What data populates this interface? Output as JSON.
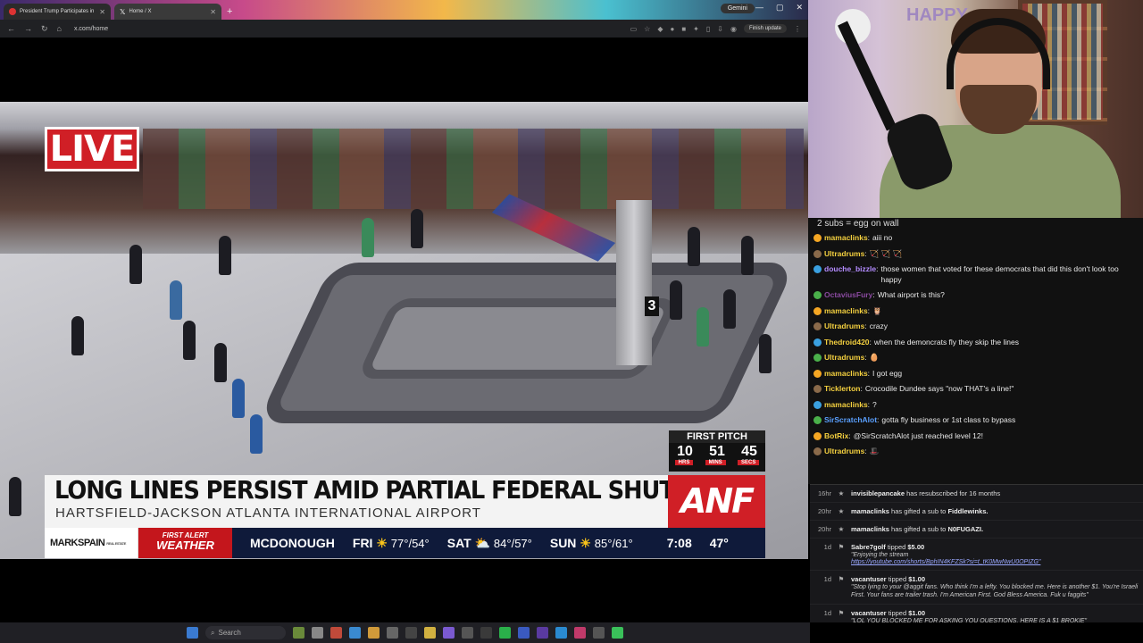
{
  "browser": {
    "tabs": [
      {
        "title": "President Trump Participates in",
        "active": false
      },
      {
        "title": "Home / X",
        "active": true
      }
    ],
    "gemini_label": "Gemini",
    "url": "x.com/home",
    "finish_update": "Finish update"
  },
  "broadcast": {
    "live": "LIVE",
    "gate_number": "3",
    "first_pitch": {
      "title": "FIRST PITCH",
      "hrs": "10",
      "mins": "51",
      "secs": "45",
      "hrs_label": "HRS",
      "mins_label": "MINS",
      "secs_label": "SECS"
    },
    "headline": "LONG LINES PERSIST AMID PARTIAL FEDERAL SHUTDOWN",
    "subheadline": "HARTSFIELD-JACKSON ATLANTA INTERNATIONAL AIRPORT",
    "network": "ANF",
    "sponsor": "MARKSPAIN",
    "sponsor_sub": "REAL ESTATE",
    "weather_label_top": "FIRST ALERT",
    "weather_label": "WEATHER",
    "city": "MCDONOUGH",
    "forecast": [
      {
        "day": "FRI",
        "temps": "77°/54°",
        "icon": "sun-icon"
      },
      {
        "day": "SAT",
        "temps": "84°/57°",
        "icon": "partly-cloudy-icon"
      },
      {
        "day": "SUN",
        "temps": "85°/61°",
        "icon": "sun-icon"
      }
    ],
    "time": "7:08",
    "current_temp": "47°"
  },
  "chat": {
    "banner": "2 subs = egg on wall",
    "messages": [
      {
        "user": "mamaclinks",
        "color": "#f4d03f",
        "text": "aiii no"
      },
      {
        "user": "Ultradrums",
        "color": "#f4d03f",
        "text": "🏹 🏹 🏹"
      },
      {
        "user": "douche_bizzle",
        "color": "#b48cff",
        "text": "those women that voted for these democrats that did this don't look too happy"
      },
      {
        "user": "OctaviusFury",
        "color": "#8a4aa0",
        "text": "What airport is this?"
      },
      {
        "user": "mamaclinks",
        "color": "#f4d03f",
        "text": "🦉"
      },
      {
        "user": "Ultradrums",
        "color": "#f4d03f",
        "text": "crazy"
      },
      {
        "user": "Thedroid420",
        "color": "#f4d03f",
        "text": "when the demoncrats fly they skip the lines"
      },
      {
        "user": "Ultradrums",
        "color": "#f4d03f",
        "text": "🥚"
      },
      {
        "user": "mamaclinks",
        "color": "#f4d03f",
        "text": "I got egg"
      },
      {
        "user": "Ticklerton",
        "color": "#f4d03f",
        "text": "Crocodile Dundee says \"now THAT's a line!\""
      },
      {
        "user": "mamaclinks",
        "color": "#f4d03f",
        "text": "?"
      },
      {
        "user": "SirScratchAlot",
        "color": "#5aa0ff",
        "text": "gotta fly business or 1st class to bypass"
      },
      {
        "user": "BotRix",
        "color": "#f4d03f",
        "text": "@SirScratchAlot just reached level 12!"
      },
      {
        "user": "Ultradrums",
        "color": "#f4d03f",
        "text": "🎩"
      }
    ]
  },
  "feed": [
    {
      "time": "16hr",
      "user": "invisiblepancake",
      "text": "has resubscribed for 16 months"
    },
    {
      "time": "20hr",
      "user": "mamaclinks",
      "text": "has gifted a sub to",
      "target": "Fiddlewinks."
    },
    {
      "time": "20hr",
      "user": "mamaclinks",
      "text": "has gifted a sub to",
      "target": "N0FUGAZI."
    },
    {
      "time": "1d",
      "user": "Sabre7golf",
      "text": "tipped",
      "amount": "$5.00",
      "message": "\"Enjoying the stream",
      "link": "https://youtube.com/shorts/BphIN4KFZSk?si=t_tK0MwNwU0OPIZG\""
    },
    {
      "time": "1d",
      "user": "vacantuser",
      "text": "tipped",
      "amount": "$1.00",
      "message": "\"Stop lying to your @aggit fans. Who think I'm a lefty. You blocked me. Here is another $1. You're Israeli First. Your fans are trailer trash. I'm American First. God Bless America. Fuk u faggits\""
    },
    {
      "time": "1d",
      "user": "vacantuser",
      "text": "tipped",
      "amount": "$1.00",
      "message": "\"LOL YOU BLOCKED ME FOR ASKING YOU QUESTIONS. HERE IS A $1 BROKIE\""
    }
  ],
  "taskbar": {
    "search": "Search"
  }
}
